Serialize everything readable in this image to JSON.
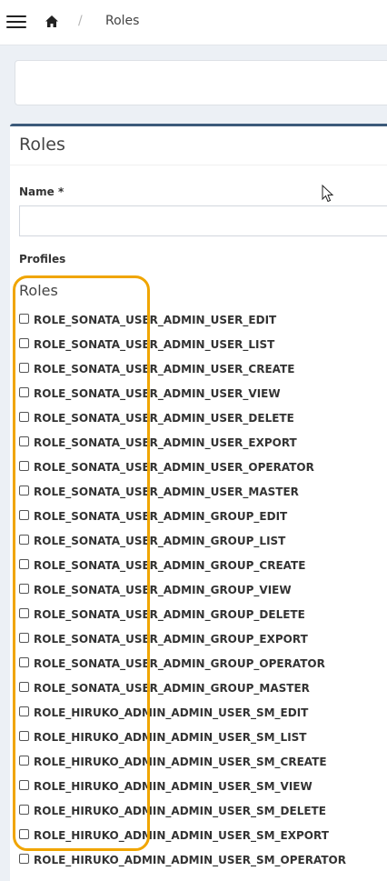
{
  "breadcrumb": {
    "current": "Roles"
  },
  "form": {
    "title": "Roles",
    "name_label": "Name *",
    "name_value": "",
    "profiles_label": "Profiles",
    "roles_heading": "Roles"
  },
  "roles": [
    "ROLE_SONATA_USER_ADMIN_USER_EDIT",
    "ROLE_SONATA_USER_ADMIN_USER_LIST",
    "ROLE_SONATA_USER_ADMIN_USER_CREATE",
    "ROLE_SONATA_USER_ADMIN_USER_VIEW",
    "ROLE_SONATA_USER_ADMIN_USER_DELETE",
    "ROLE_SONATA_USER_ADMIN_USER_EXPORT",
    "ROLE_SONATA_USER_ADMIN_USER_OPERATOR",
    "ROLE_SONATA_USER_ADMIN_USER_MASTER",
    "ROLE_SONATA_USER_ADMIN_GROUP_EDIT",
    "ROLE_SONATA_USER_ADMIN_GROUP_LIST",
    "ROLE_SONATA_USER_ADMIN_GROUP_CREATE",
    "ROLE_SONATA_USER_ADMIN_GROUP_VIEW",
    "ROLE_SONATA_USER_ADMIN_GROUP_DELETE",
    "ROLE_SONATA_USER_ADMIN_GROUP_EXPORT",
    "ROLE_SONATA_USER_ADMIN_GROUP_OPERATOR",
    "ROLE_SONATA_USER_ADMIN_GROUP_MASTER",
    "ROLE_HIRUKO_ADMIN_ADMIN_USER_SM_EDIT",
    "ROLE_HIRUKO_ADMIN_ADMIN_USER_SM_LIST",
    "ROLE_HIRUKO_ADMIN_ADMIN_USER_SM_CREATE",
    "ROLE_HIRUKO_ADMIN_ADMIN_USER_SM_VIEW",
    "ROLE_HIRUKO_ADMIN_ADMIN_USER_SM_DELETE",
    "ROLE_HIRUKO_ADMIN_ADMIN_USER_SM_EXPORT",
    "ROLE_HIRUKO_ADMIN_ADMIN_USER_SM_OPERATOR"
  ],
  "colors": {
    "highlight": "#f0a500",
    "panel_accent": "#3c5a7a",
    "background": "#ecf0f5"
  }
}
